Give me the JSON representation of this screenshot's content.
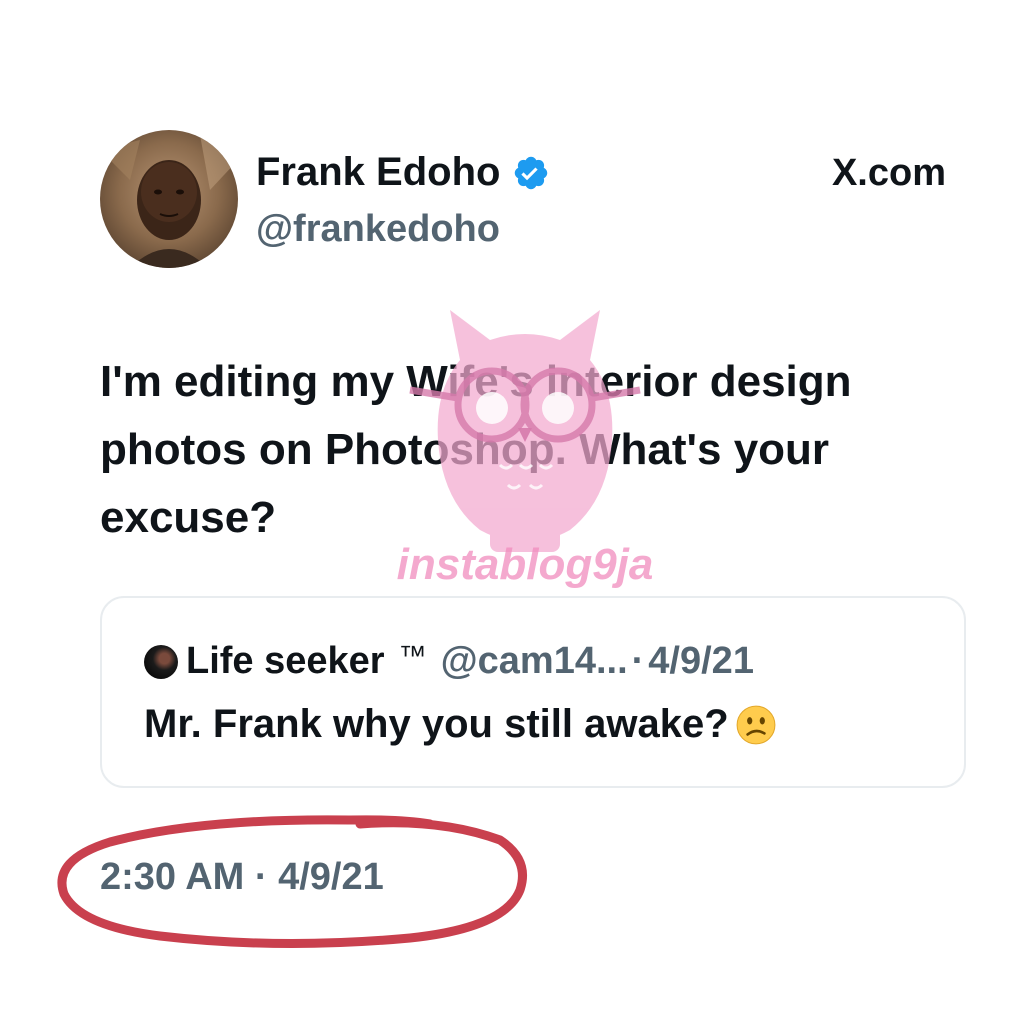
{
  "author": {
    "name": "Frank Edoho",
    "handle": "@frankedoho",
    "verified": true,
    "avatar_icon": "profile-photo"
  },
  "source_label": "X.com",
  "tweet": {
    "text": "I'm editing my Wife's interior design photos on Photoshop. What's your excuse?"
  },
  "watermark": {
    "text": "instablog9ja",
    "color": "#f08cbe"
  },
  "quoted_tweet": {
    "name": "Life seeker",
    "tm": "™",
    "handle": "@cam14...",
    "separator": "·",
    "date": "4/9/21",
    "text": "Mr. Frank why you still awake?",
    "emoji_icon": "confused-face-icon"
  },
  "timestamp": "2:30 AM · 4/9/21",
  "colors": {
    "verified_blue": "#1d9bf0",
    "annotation_red": "#c9404e",
    "primary_text": "#0f1419",
    "secondary_text": "#536471"
  }
}
